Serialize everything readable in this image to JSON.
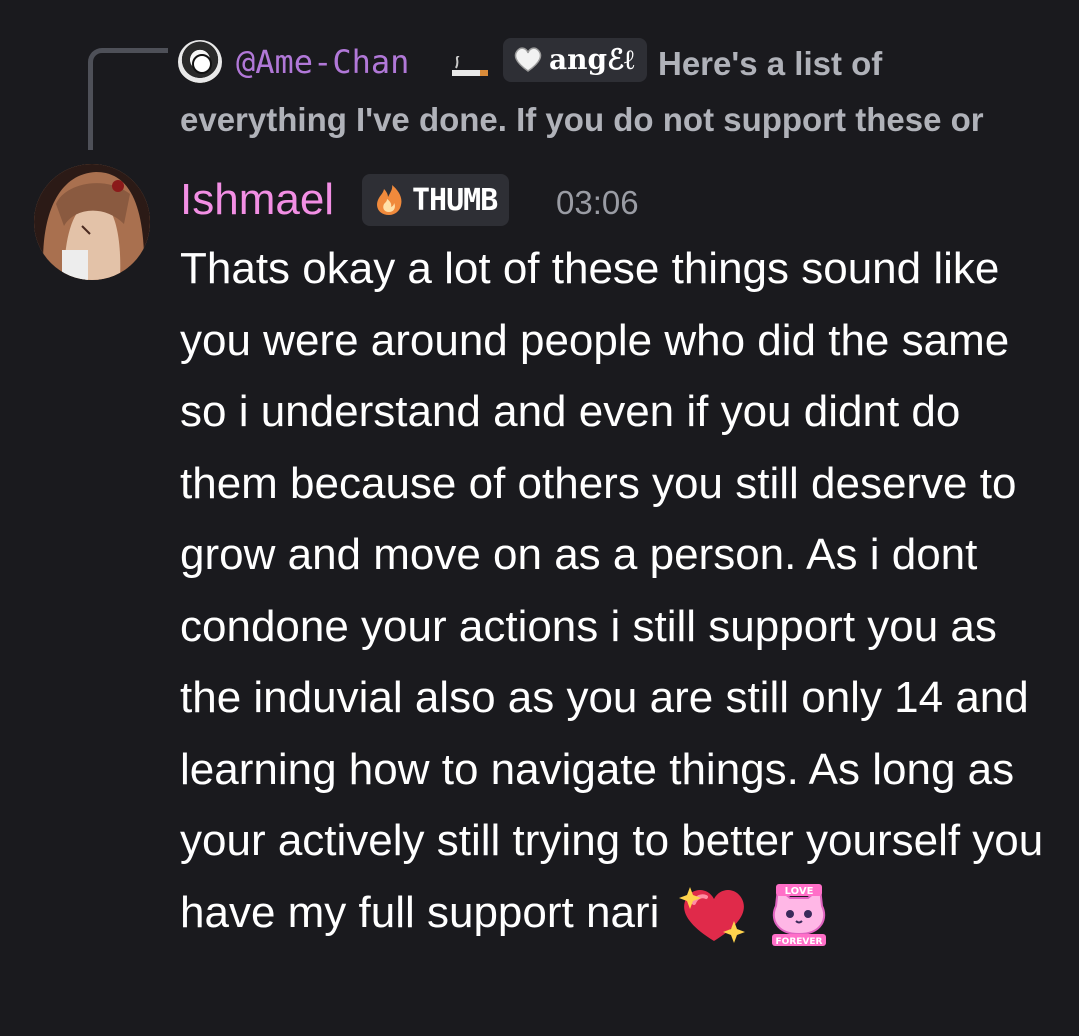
{
  "reply": {
    "username": "@Ame-Chan",
    "tag_icon": "heart-icon",
    "tag_label": "angℰℓ",
    "text": "Here's a list of everything I've done. If you do not support these or"
  },
  "message": {
    "author": "Ishmael",
    "role_icon": "fire-icon",
    "role_label": "THUMB",
    "timestamp": "03:06",
    "content": "Thats okay a lot of these things sound like you were around people who did the same so i understand and even if you didnt do them because of others you still deserve to grow and move on as a person. As i dont condone your actions i still support you as the induvial also as you are still only 14 and learning how to navigate things.  As long as your actively still trying to better yourself you have my full support nari",
    "trailing_emojis": [
      "sparkling-heart-icon",
      "love-forever-cat-icon"
    ],
    "sticker_text": [
      "LOVE",
      "FOREVER"
    ]
  },
  "colors": {
    "background": "#1a1a1e",
    "reply_username": "#b178d8",
    "author": "#f28fe4",
    "reply_text": "#b0b2b9",
    "timestamp": "#9a9ca4",
    "tag_bg": "#2e2f35"
  }
}
